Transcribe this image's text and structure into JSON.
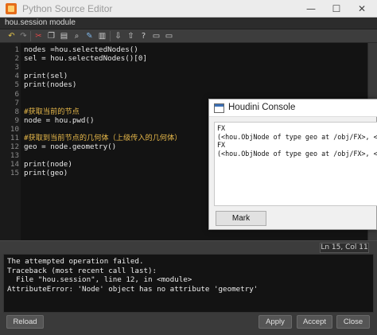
{
  "window": {
    "title": "Python Source Editor",
    "minimize": "—",
    "maximize": "☐",
    "close": "✕"
  },
  "module": {
    "label": "hou.session module"
  },
  "toolbar": {
    "icons": [
      "undo-icon",
      "redo-icon",
      "cut-icon",
      "copy-icon",
      "paste-icon",
      "search-icon",
      "replace-icon",
      "import-icon",
      "export-icon",
      "help-icon",
      "comment-icon",
      "uncomment-icon"
    ]
  },
  "code_lines": [
    {
      "n": "1",
      "text": "nodes =hou.selectedNodes()",
      "comment": false
    },
    {
      "n": "2",
      "text": "sel = hou.selectedNodes()[0]",
      "comment": false
    },
    {
      "n": "3",
      "text": "",
      "comment": false
    },
    {
      "n": "4",
      "text": "print(sel)",
      "comment": false
    },
    {
      "n": "5",
      "text": "print(nodes)",
      "comment": false
    },
    {
      "n": "6",
      "text": "",
      "comment": false
    },
    {
      "n": "7",
      "text": "",
      "comment": false
    },
    {
      "n": "8",
      "text": "#获取当前的节点",
      "comment": true
    },
    {
      "n": "9",
      "text": "node = hou.pwd()",
      "comment": false
    },
    {
      "n": "10",
      "text": "",
      "comment": false
    },
    {
      "n": "11",
      "text": "#获取到当前节点的几何体（上级传入的几何体）",
      "comment": true
    },
    {
      "n": "12",
      "text": "geo = node.geometry()",
      "comment": false
    },
    {
      "n": "13",
      "text": "",
      "comment": false
    },
    {
      "n": "14",
      "text": "print(node)",
      "comment": false
    },
    {
      "n": "15",
      "text": "print(geo)",
      "comment": false
    }
  ],
  "status": {
    "position": "Ln 15, Col 11"
  },
  "output_lines": [
    "The attempted operation failed.",
    "Traceback (most recent call last):",
    "  File \"hou.session\", line 12, in <module>",
    "AttributeError: 'Node' object has no attribute 'geometry'"
  ],
  "buttons": {
    "reload": "Reload",
    "apply": "Apply",
    "accept": "Accept",
    "close": "Close"
  },
  "console": {
    "title": "Houdini Console",
    "lines": [
      "FX",
      "(<hou.ObjNode of type geo at /obj/FX>, <hou",
      "FX",
      "(<hou.ObjNode of type geo at /obj/FX>, <hou"
    ],
    "mark": "Mark"
  }
}
